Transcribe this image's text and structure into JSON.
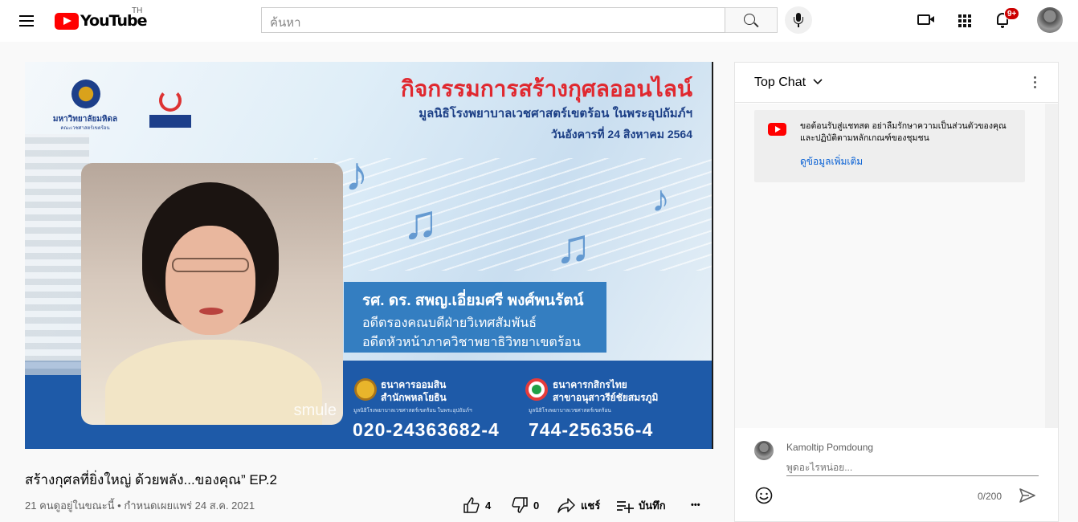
{
  "header": {
    "logo_text": "YouTube",
    "country_code": "TH",
    "search_placeholder": "ค้นหา",
    "notification_count": "9+"
  },
  "video_frame": {
    "title": "กิจกรรมการสร้างกุศลออนไลน์",
    "subtitle": "มูลนิธิโรงพยาบาลเวชศาสตร์เขตร้อน ในพระอุปถัมภ์ฯ",
    "date": "วันอังคารที่ 24 สิงหาคม 2564",
    "logo_name": "มหาวิทยาลัยมหิดล",
    "logo_sub": "คณะเวชศาสตร์เขตร้อน",
    "speaker_name": "รศ. ดร. สพญ.เอี่ยมศรี  พงศ์พนรัตน์",
    "speaker_role1": "อดีตรองคณบดีฝ่ายวิเทศสัมพันธ์",
    "speaker_role2": "อดีตหัวหน้าภาควิชาพยาธิวิทยาเขตร้อน",
    "watermark": "smule",
    "bank1": {
      "name": "ธนาคารออมสิน",
      "branch": "สำนักพหลโยธิน",
      "account_name": "มูลนิธิโรงพยาบาลเวชศาสตร์เขตร้อน ในพระอุปถัมภ์ฯ",
      "number": "020-24363682-4"
    },
    "bank2": {
      "name": "ธนาคารกสิกรไทย",
      "branch": "สาขาอนุสาวรีย์ชัยสมรภูมิ",
      "account_name": "มูลนิธิโรงพยาบาลเวชศาสตร์เขตร้อน",
      "number": "744-256356-4"
    }
  },
  "video_info": {
    "title": "สร้างกุศลที่ยิ่งใหญ่ ด้วยพลัง...ของคุณ” EP.2",
    "meta": "21 คนดูอยู่ในขณะนี้ • กำหนดเผยแพร่ 24 ส.ค. 2021",
    "likes": "4",
    "dislikes": "0",
    "share_label": "แชร์",
    "save_label": "บันทึก",
    "more_label": "•••"
  },
  "chat": {
    "title": "Top Chat",
    "notice_text": "ขอต้อนรับสู่แชทสด อย่าลืมรักษาความเป็นส่วนตัวของคุณและปฏิบัติตามหลักเกณฑ์ของชุมชน",
    "notice_link": "ดูข้อมูลเพิ่มเติม",
    "user_name": "Kamoltip Pomdoung",
    "input_placeholder": "พูดอะไรหน่อย...",
    "char_count": "0/200"
  },
  "colors": {
    "brand": "#ff0000",
    "link": "#065fd4",
    "badge": "#cc0000"
  }
}
